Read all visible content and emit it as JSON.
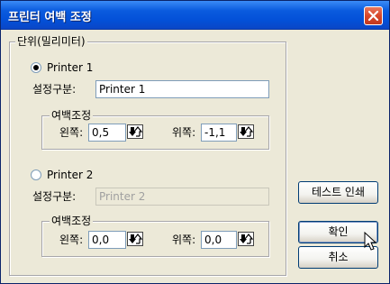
{
  "window": {
    "title": "프린터 여백 조정"
  },
  "unit_group": {
    "label": "단위(밀리미터)"
  },
  "printer1": {
    "radio_label": "Printer 1",
    "checked": true,
    "setting_label": "설정구분:",
    "setting_value": "Printer 1",
    "margin_group_label": "여백조정",
    "left_label": "왼쪽:",
    "left_value": "0,5",
    "top_label": "위쪽:",
    "top_value": "-1,1"
  },
  "printer2": {
    "radio_label": "Printer 2",
    "checked": false,
    "setting_label": "설정구분:",
    "setting_value": "Printer 2",
    "margin_group_label": "여백조정",
    "left_label": "왼쪽:",
    "left_value": "0,0",
    "top_label": "위쪽:",
    "top_value": "0,0"
  },
  "buttons": {
    "test_print": "테스트 인쇄",
    "ok": "확인",
    "cancel": "취소"
  },
  "icons": {
    "close": "close-icon",
    "spinner": "spinner-arrows-icon",
    "cursor": "mouse-pointer-icon"
  }
}
